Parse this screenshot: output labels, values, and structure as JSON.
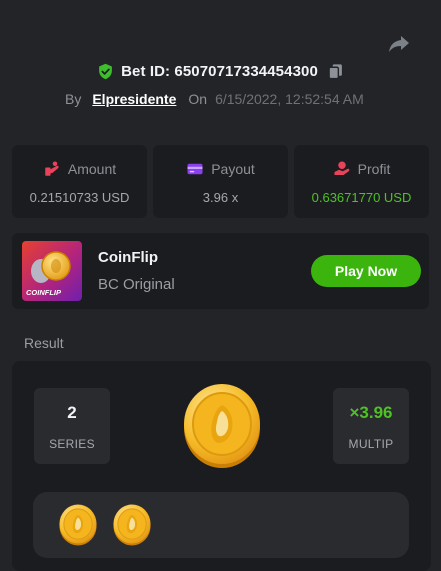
{
  "header": {
    "bet_id": "Bet ID: 6507071733445430​0",
    "by_label": "By",
    "username": "Elpresidente",
    "on_label": "On",
    "timestamp": "6/15/2022, 12:52:54 AM"
  },
  "stats": {
    "amount": {
      "label": "Amount",
      "value": "0.21510733 USD"
    },
    "payout": {
      "label": "Payout",
      "value": "3.96 x"
    },
    "profit": {
      "label": "Profit",
      "value": "0.63671770 USD"
    }
  },
  "game": {
    "thumb_text": "COINFLIP",
    "title": "CoinFlip",
    "subtitle": "BC Original",
    "play_label": "Play Now"
  },
  "result": {
    "label": "Result",
    "series_value": "2",
    "series_label": "SERIES",
    "multiplier_value": "×3.96",
    "multiplier_label": "MULTIP",
    "history_count": 2
  },
  "colors": {
    "background": "#232427",
    "card": "#1b1c1f",
    "accent_green": "#3bb40e",
    "profit_green": "#4fc125",
    "amount_icon": "#e8435a",
    "payout_icon": "#8b3ff0",
    "profit_icon": "#e8435a",
    "coin_gold": "#f3b51c"
  },
  "icons": [
    "share-icon",
    "shield-check-icon",
    "copy-icon",
    "amount-icon",
    "payout-card-icon",
    "profit-icon",
    "coin-icon"
  ]
}
